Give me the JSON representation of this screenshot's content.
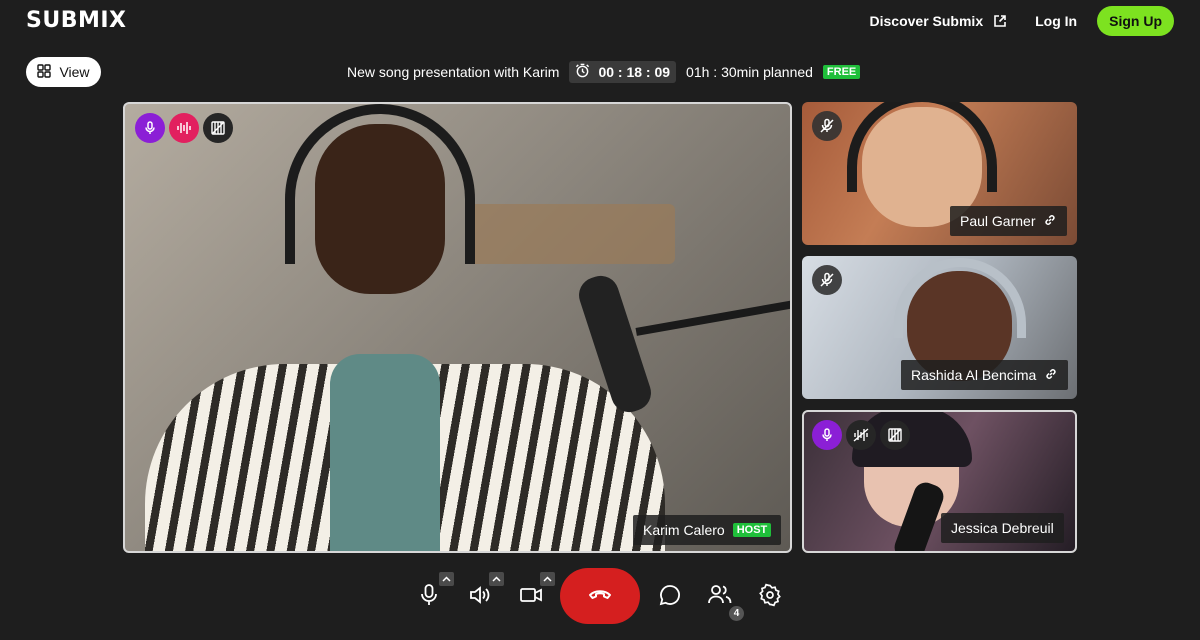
{
  "header": {
    "logo": "SUBMIX",
    "discover_label": "Discover Submix",
    "login_label": "Log In",
    "signup_label": "Sign Up"
  },
  "view_button": {
    "label": "View"
  },
  "session": {
    "title": "New song presentation with Karim",
    "timer": "00 : 18 : 09",
    "planned": "01h : 30min planned",
    "plan_badge": "FREE"
  },
  "participants": {
    "main": {
      "name": "Karim Calero",
      "role_badge": "HOST"
    },
    "side": [
      {
        "name": "Paul Garner"
      },
      {
        "name": "Rashida Al Bencima"
      },
      {
        "name": "Jessica Debreuil"
      }
    ]
  },
  "controls": {
    "participant_count": "4"
  },
  "colors": {
    "background": "#1e1e1e",
    "accent_green": "#7de220",
    "badge_green": "#1fbf3a",
    "end_call_red": "#d51f1f",
    "mic_purple": "#8b1fd6",
    "audio_pink": "#e2205f"
  },
  "icons": [
    "external-link-icon",
    "grid-icon",
    "timer-icon",
    "mic-icon",
    "audio-wave-icon",
    "video-off-icon",
    "mic-off-icon",
    "link-icon",
    "speaker-icon",
    "camera-icon",
    "chevron-up-icon",
    "hangup-icon",
    "chat-icon",
    "people-icon",
    "settings-icon"
  ]
}
